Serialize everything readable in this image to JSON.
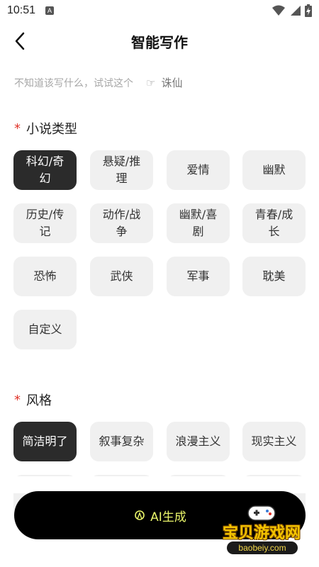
{
  "status_bar": {
    "time": "10:51",
    "notification_icon": "a-icon",
    "icons": [
      "wifi-icon",
      "signal-icon",
      "battery-icon"
    ]
  },
  "header": {
    "back_icon": "chevron-left-icon",
    "title": "智能写作"
  },
  "hint": {
    "text": "不知道该写什么，试试这个",
    "icon": "pointing-hand-icon",
    "suggestion": "诛仙"
  },
  "genre_section": {
    "required_mark": "*",
    "title": "小说类型",
    "options": [
      {
        "label": "科幻/奇幻",
        "selected": true
      },
      {
        "label": "悬疑/推理",
        "selected": false
      },
      {
        "label": "爱情",
        "selected": false
      },
      {
        "label": "幽默",
        "selected": false
      },
      {
        "label": "历史/传记",
        "selected": false
      },
      {
        "label": "动作/战争",
        "selected": false
      },
      {
        "label": "幽默/喜剧",
        "selected": false
      },
      {
        "label": "青春/成长",
        "selected": false
      },
      {
        "label": "恐怖",
        "selected": false
      },
      {
        "label": "武侠",
        "selected": false
      },
      {
        "label": "军事",
        "selected": false
      },
      {
        "label": "耽美",
        "selected": false
      },
      {
        "label": "自定义",
        "selected": false
      }
    ]
  },
  "style_section": {
    "required_mark": "*",
    "title": "风格",
    "options": [
      {
        "label": "简洁明了",
        "selected": true
      },
      {
        "label": "叙事复杂",
        "selected": false
      },
      {
        "label": "浪漫主义",
        "selected": false
      },
      {
        "label": "现实主义",
        "selected": false
      }
    ]
  },
  "generate_button": {
    "label": "AI生成",
    "icon": "ai-sparkle-icon"
  },
  "watermark": {
    "text": "宝贝游戏网",
    "domain": "baobeiy.com"
  },
  "colors": {
    "selected_chip": "#2b2b2b",
    "chip": "#f0f0f0",
    "required": "#e0342a",
    "button_bg": "#000000",
    "button_text": "#e9f56a"
  }
}
